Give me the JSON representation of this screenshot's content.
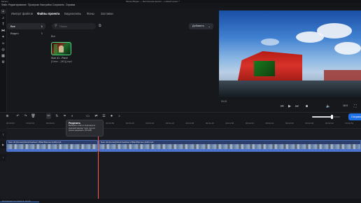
{
  "window": {
    "title": "Movavi Видео — Бесплатная версия — Новый проект *",
    "app_short": "Movavi"
  },
  "menu": [
    "Файл",
    "Редактирование",
    "Проигрыв.",
    "Настройки",
    "Сохранить",
    "Справка"
  ],
  "tabs": [
    {
      "label": "Импорт файлов",
      "active": false
    },
    {
      "label": "Файлы проекта",
      "active": true
    },
    {
      "label": "Видеоклипы",
      "active": false
    },
    {
      "label": "Фоны",
      "active": false
    },
    {
      "label": "Заставки",
      "active": false
    }
  ],
  "categories": [
    {
      "label": "Все",
      "count": "1",
      "selected": true
    },
    {
      "label": "Видео",
      "count": "1",
      "selected": false
    }
  ],
  "search": {
    "placeholder": "Поиск",
    "value": ""
  },
  "add_button": "Добавить",
  "group_label": "Все",
  "media_item": {
    "caption_line1": "Sum 41 - Parot",
    "caption_line2": "[Colov... (HD)].mp4"
  },
  "preview": {
    "timecode": "00:15",
    "zoom": "16:9",
    "controls": [
      "skip-back",
      "play",
      "skip-forward",
      "fullscreen",
      "volume",
      "snapshot"
    ],
    "volume_level": 0.7
  },
  "timeline_toolbar": {
    "tools": [
      "add-track",
      "undo",
      "redo",
      "delete",
      "cut",
      "rotate",
      "crop",
      "color",
      "split",
      "transition",
      "clip-properties",
      "record",
      "audio"
    ],
    "export_label": "Сохранить"
  },
  "tooltip": {
    "title": "Разрезать",
    "description": "Выберите клип и перетащите красный маркер туда, где его нужно разрезать. (Ctrl+B)"
  },
  "ruler": [
    "00:00:00",
    "00:00:10",
    "00:00:20",
    "00:00:30",
    "00:00:40",
    "00:00:50",
    "00:01:00",
    "00:01:10",
    "00:01:20",
    "00:01:30",
    "00:01:40",
    "00:01:50",
    "00:02:00",
    "00:02:10",
    "00:02:20",
    "00:02:30",
    "00:02:40",
    "00:02:50"
  ],
  "clips": [
    {
      "title": "Sum 41 [Comet] Rock Festival 1 Bhai Bhomen [HD].mp4"
    },
    {
      "title": "Sum 41 [Comet] Rock Festival 1 Bhai Bhomen [HD].mp4"
    }
  ],
  "status_text": "Длительность проекта: 01:18"
}
